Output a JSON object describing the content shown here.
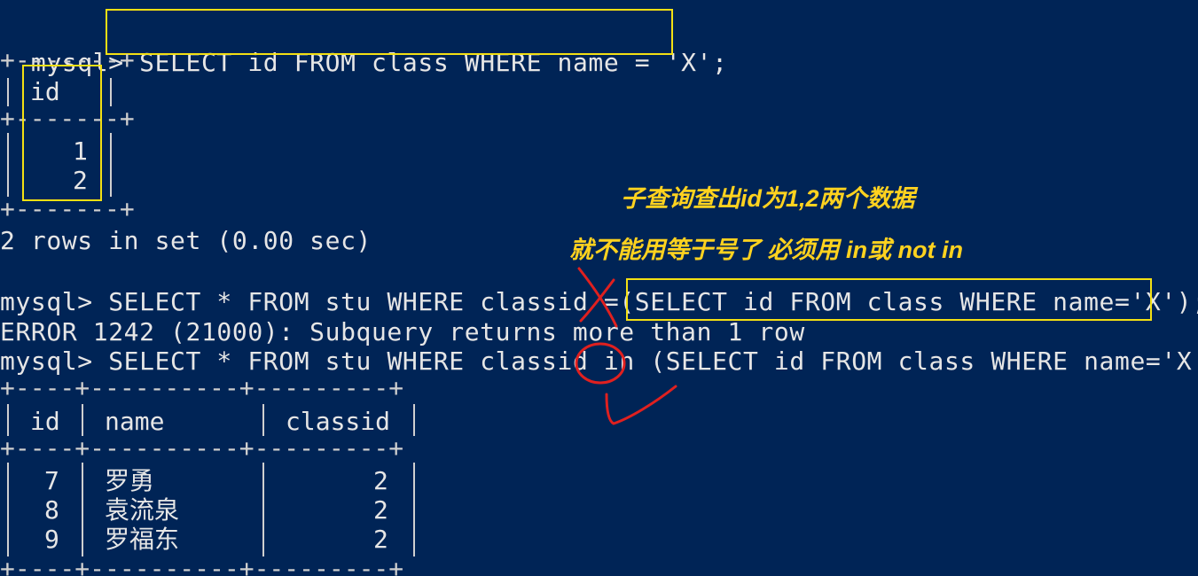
{
  "colors": {
    "background": "#002456",
    "text": "#e6e6e6",
    "highlight_box": "#f3e013",
    "annotation_text": "#ffd21f",
    "annotation_ink": "#e0201f"
  },
  "query1": {
    "prompt": "mysql>",
    "sql": "SELECT id FROM class WHERE name = 'X';",
    "border_line": "+-------+",
    "header": "id",
    "values": [
      "1",
      "2"
    ],
    "status": "2 rows in set (0.00 sec)"
  },
  "annotations": {
    "line1": "子查询查出id为1,2两个数据",
    "line2": "就不能用等于号了 必须用 in或 not in"
  },
  "query2": {
    "prompt": "mysql>",
    "sql_prefix": "SELECT * FROM stu WHERE classid",
    "operator": "=",
    "subquery": "(SELECT id FROM class WHERE name='X')",
    "terminator": ";",
    "error": "ERROR 1242 (21000): Subquery returns more than 1 row"
  },
  "query3": {
    "prompt": "mysql>",
    "sql_prefix": "SELECT * FROM stu WHERE classid",
    "operator": "in",
    "subquery": "(SELECT id FROM class WHERE name='X');",
    "border_line": "+----+----------+---------+",
    "headers": [
      "id",
      "name",
      "classid"
    ],
    "rows": [
      {
        "id": "7",
        "name": "罗勇",
        "classid": "2"
      },
      {
        "id": "8",
        "name": "袁流泉",
        "classid": "2"
      },
      {
        "id": "9",
        "name": "罗福东",
        "classid": "2"
      }
    ]
  }
}
